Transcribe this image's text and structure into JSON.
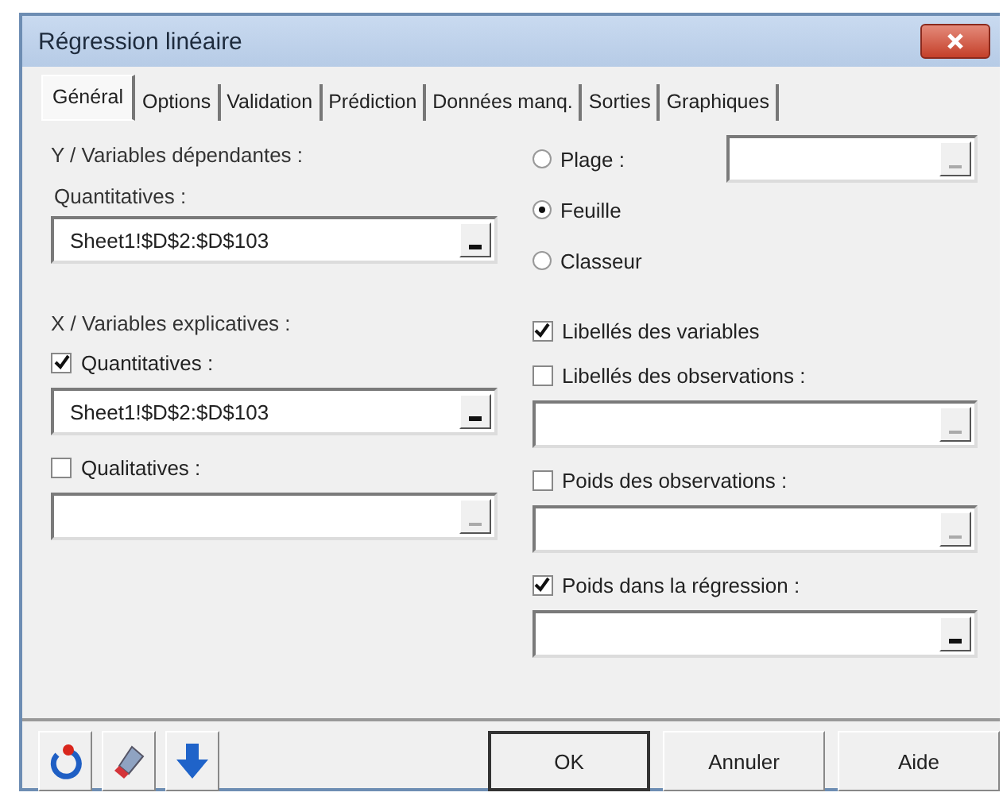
{
  "window": {
    "title": "Régression linéaire"
  },
  "tabs": [
    {
      "label": "Général",
      "selected": true
    },
    {
      "label": "Options",
      "selected": false
    },
    {
      "label": "Validation",
      "selected": false
    },
    {
      "label": "Prédiction",
      "selected": false
    },
    {
      "label": "Données manq.",
      "selected": false
    },
    {
      "label": "Sorties",
      "selected": false
    },
    {
      "label": "Graphiques",
      "selected": false
    }
  ],
  "left_groups": [
    [
      {
        "kind": "heading",
        "label": "Y / Variables dépendantes :"
      },
      {
        "kind": "label",
        "label": "Quantitatives :"
      },
      {
        "kind": "field",
        "value": "Sheet1!$D$2:$D$103",
        "picker_enabled": true
      }
    ],
    [
      {
        "kind": "heading",
        "label": "X / Variables explicatives :"
      },
      {
        "kind": "checkbox",
        "label": "Quantitatives :",
        "checked": true
      },
      {
        "kind": "field",
        "value": "Sheet1!$D$2:$D$103",
        "picker_enabled": true
      },
      {
        "kind": "checkbox",
        "label": "Qualitatives :",
        "checked": false
      },
      {
        "kind": "field",
        "picker_enabled": false
      }
    ]
  ],
  "right_groups": [
    [
      {
        "kind": "radio",
        "label": "Plage :",
        "selected": false,
        "field": {
          "picker_enabled": false
        }
      },
      {
        "kind": "radio",
        "label": "Feuille",
        "selected": true
      },
      {
        "kind": "radio",
        "label": "Classeur",
        "selected": false
      }
    ],
    [
      {
        "kind": "checkbox",
        "label": "Libellés des variables",
        "checked": true
      },
      {
        "kind": "checkbox",
        "label": "Libellés des observations :",
        "checked": false
      },
      {
        "kind": "field",
        "picker_enabled": false
      },
      {
        "kind": "checkbox",
        "label": "Poids des observations :",
        "checked": false
      },
      {
        "kind": "field",
        "picker_enabled": false
      },
      {
        "kind": "checkbox",
        "label": "Poids dans la régression :",
        "checked": true
      },
      {
        "kind": "field",
        "picker_enabled": true
      }
    ]
  ],
  "buttons": [
    {
      "label": "OK",
      "default": true
    },
    {
      "label": "Annuler",
      "default": false
    },
    {
      "label": "Aide",
      "default": false
    }
  ]
}
